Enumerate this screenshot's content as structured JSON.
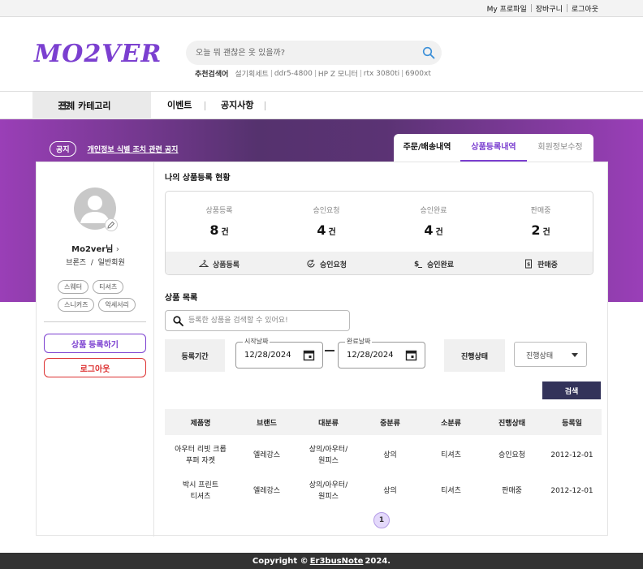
{
  "topbar": {
    "links": [
      "My 프로파일",
      "장바구니",
      "로그아웃"
    ]
  },
  "header": {
    "logo": "MO2VER",
    "search_placeholder": "오늘 뭐 괜찮은 옷 있을까?",
    "rec_title": "추천검색어",
    "keywords": [
      "설기획세트",
      "ddr5-4800",
      "HP Z 모니터",
      "rtx 3080ti",
      "6900xt"
    ]
  },
  "nav": {
    "category": "전체 카테고리",
    "items": [
      "이벤트",
      "공지사항"
    ]
  },
  "notice": {
    "badge": "공지",
    "text": "개인정보 식별 조치 관련 공지"
  },
  "tabs": [
    "주문/배송내역",
    "상품등록내역",
    "회원정보수정"
  ],
  "profile": {
    "username": "Mo2ver님",
    "grade": "브론즈",
    "member_type": "일반회원",
    "tags": [
      "스웨터",
      "티셔츠",
      "스니커즈",
      "악세서리"
    ],
    "register_button": "상품 등록하기",
    "logout_button": "로그아웃"
  },
  "status": {
    "title": "나의 상품등록 현황",
    "items": [
      {
        "label": "상품등록",
        "count": "8",
        "unit": "건",
        "foot": "상품등록"
      },
      {
        "label": "승인요청",
        "count": "4",
        "unit": "건",
        "foot": "승인요청"
      },
      {
        "label": "승인완료",
        "count": "4",
        "unit": "건",
        "foot": "승인완료"
      },
      {
        "label": "판매중",
        "count": "2",
        "unit": "건",
        "foot": "판매중"
      }
    ]
  },
  "list": {
    "title": "상품 목록",
    "search_placeholder": "등록한 상품을 검색할 수 있어요!",
    "period_label": "등록기간",
    "start_label": "시작날짜",
    "start_value": "12/28/2024",
    "end_label": "완료날짜",
    "end_value": "12/28/2024",
    "status_label": "진행상태",
    "status_select": "진행상태",
    "search_button": "검색",
    "columns": [
      "제품명",
      "브랜드",
      "대분류",
      "중분류",
      "소분류",
      "진행상태",
      "등록일"
    ],
    "rows": [
      [
        "아우터 리빗 크롭 푸퍼 자켓",
        "엘레강스",
        "상의/아우터/원피스",
        "상의",
        "티셔츠",
        "승인요청",
        "2012-12-01"
      ],
      [
        "박시 프린트 티셔츠",
        "엘레강스",
        "상의/아우터/원피스",
        "상의",
        "티셔츠",
        "판매중",
        "2012-12-01"
      ]
    ],
    "page": "1"
  },
  "footer": {
    "prefix": "Copyright ©",
    "name": "Er3busNote",
    "suffix": "2024."
  }
}
